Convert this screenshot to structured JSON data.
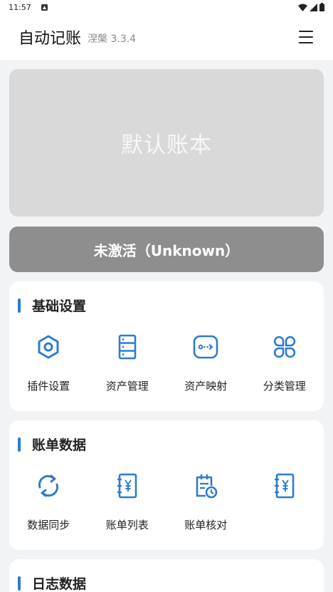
{
  "status_bar": {
    "time": "11:57"
  },
  "app_bar": {
    "title": "自动记账",
    "subtitle": "涅槃 3.3.4"
  },
  "book_card": {
    "name": "默认账本"
  },
  "activation": {
    "label": "未激活（Unknown）"
  },
  "sections": [
    {
      "title": "基础设置",
      "items": [
        {
          "label": "插件设置",
          "icon": "hexagon-settings-icon"
        },
        {
          "label": "资产管理",
          "icon": "stack-list-icon"
        },
        {
          "label": "资产映射",
          "icon": "mapping-arrow-icon"
        },
        {
          "label": "分类管理",
          "icon": "category-petals-icon"
        }
      ]
    },
    {
      "title": "账单数据",
      "items": [
        {
          "label": "数据同步",
          "icon": "sync-icon"
        },
        {
          "label": "账单列表",
          "icon": "bill-book-icon"
        },
        {
          "label": "账单核对",
          "icon": "calendar-clock-icon"
        },
        {
          "label": "",
          "icon": "bill-book-icon"
        }
      ]
    },
    {
      "title": "日志数据",
      "items": []
    }
  ],
  "colors": {
    "accent": "#2e7bd0",
    "background": "#f2f3f5",
    "book_card": "#d9d9d9",
    "activate_button": "#8e8e8e"
  }
}
